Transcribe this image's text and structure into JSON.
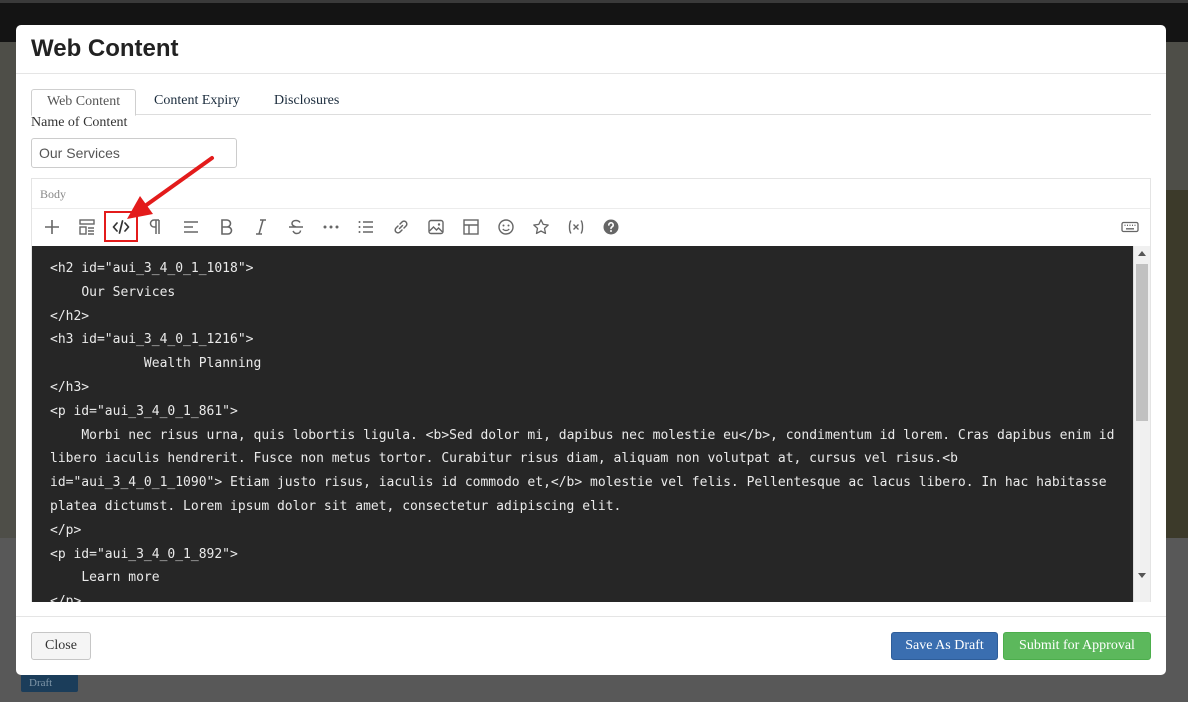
{
  "background": {
    "draft_badge": "Draft"
  },
  "modal": {
    "title": "Web Content",
    "tabs": [
      {
        "label": "Web Content",
        "active": true
      },
      {
        "label": "Content Expiry",
        "active": false
      },
      {
        "label": "Disclosures",
        "active": false
      }
    ],
    "name_field": {
      "label": "Name of Content",
      "value": "Our Services"
    },
    "editor": {
      "label": "Body",
      "toolbar": [
        {
          "icon": "plus-icon",
          "highlighted": false
        },
        {
          "icon": "template-icon",
          "highlighted": false
        },
        {
          "icon": "code-view-icon",
          "highlighted": true
        },
        {
          "icon": "paragraph-icon",
          "highlighted": false
        },
        {
          "icon": "align-icon",
          "highlighted": false
        },
        {
          "icon": "bold-icon",
          "highlighted": false
        },
        {
          "icon": "italic-icon",
          "highlighted": false
        },
        {
          "icon": "strikethrough-icon",
          "highlighted": false
        },
        {
          "icon": "more-icon",
          "highlighted": false
        },
        {
          "icon": "list-icon",
          "highlighted": false
        },
        {
          "icon": "link-icon",
          "highlighted": false
        },
        {
          "icon": "image-icon",
          "highlighted": false
        },
        {
          "icon": "table-icon",
          "highlighted": false
        },
        {
          "icon": "emoji-icon",
          "highlighted": false
        },
        {
          "icon": "star-icon",
          "highlighted": false
        },
        {
          "icon": "variable-icon",
          "highlighted": false
        },
        {
          "icon": "help-icon",
          "highlighted": false
        },
        {
          "icon": "keyboard-icon",
          "highlighted": false
        }
      ],
      "code": "<h2 id=\"aui_3_4_0_1_1018\">\n    Our Services\n</h2>\n<h3 id=\"aui_3_4_0_1_1216\">\n            Wealth Planning\n</h3>\n<p id=\"aui_3_4_0_1_861\">\n    Morbi nec risus urna, quis lobortis ligula. <b>Sed dolor mi, dapibus nec molestie eu</b>, condimentum id lorem. Cras dapibus enim id libero iaculis hendrerit. Fusce non metus tortor. Curabitur risus diam, aliquam non volutpat at, cursus vel risus.<b id=\"aui_3_4_0_1_1090\"> Etiam justo risus, iaculis id commodo et,</b> molestie vel felis. Pellentesque ac lacus libero. In hac habitasse platea dictumst. Lorem ipsum dolor sit amet, consectetur adipiscing elit.\n</p>\n<p id=\"aui_3_4_0_1_892\">\n    Learn more\n</p>"
    },
    "footer": {
      "close_label": "Close",
      "save_draft_label": "Save As Draft",
      "submit_label": "Submit for Approval"
    }
  },
  "colors": {
    "primary": "#3a6eb0",
    "success": "#5cb85c",
    "code_bg": "#262626",
    "annotation_red": "#e31b1b"
  }
}
